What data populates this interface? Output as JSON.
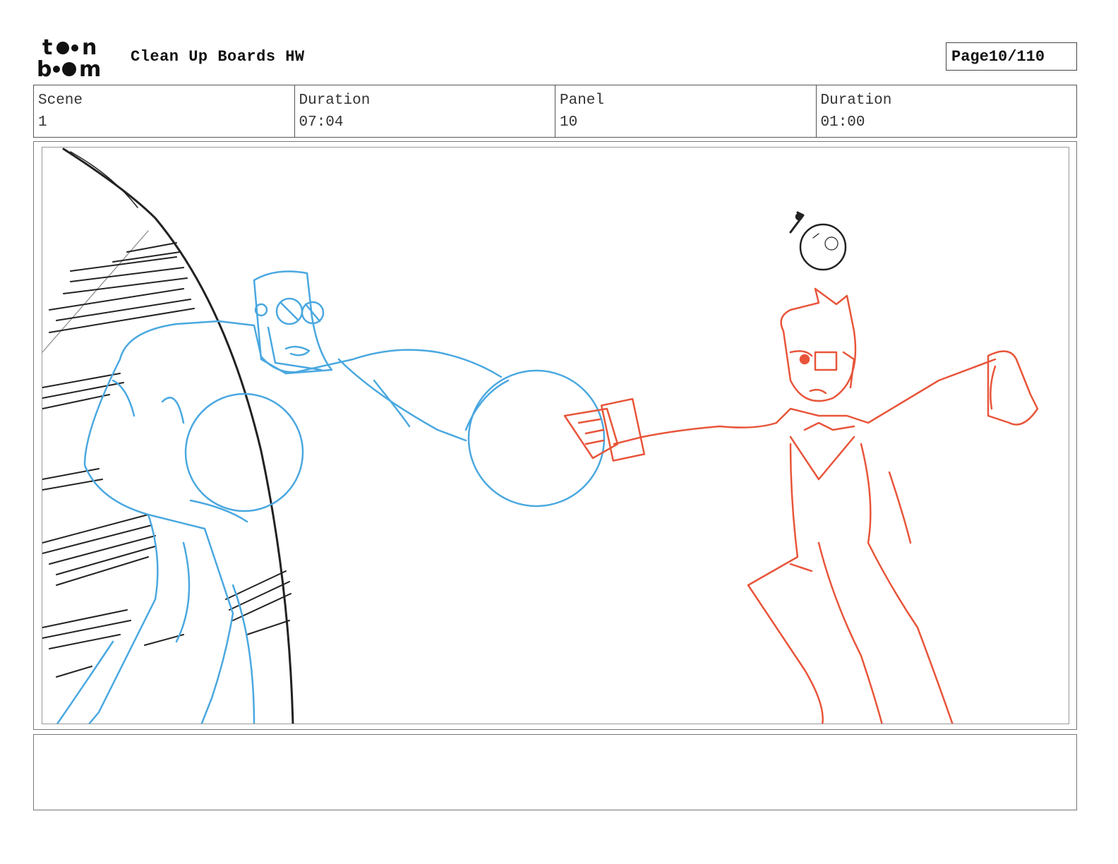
{
  "header": {
    "logo_text": "toon boom",
    "title": "Clean Up Boards HW",
    "page_label": "Page",
    "page_value": "10/110"
  },
  "info": {
    "scene_label": "Scene",
    "scene_value": "1",
    "scene_duration_label": "Duration",
    "scene_duration_value": "07:04",
    "panel_label": "Panel",
    "panel_value": "10",
    "panel_duration_label": "Duration",
    "panel_duration_value": "01:00"
  },
  "panel": {
    "colors": {
      "villain": "#4aa8e0",
      "hero": "#e8553a",
      "background": "#222222"
    }
  },
  "notes": {
    "text": ""
  }
}
